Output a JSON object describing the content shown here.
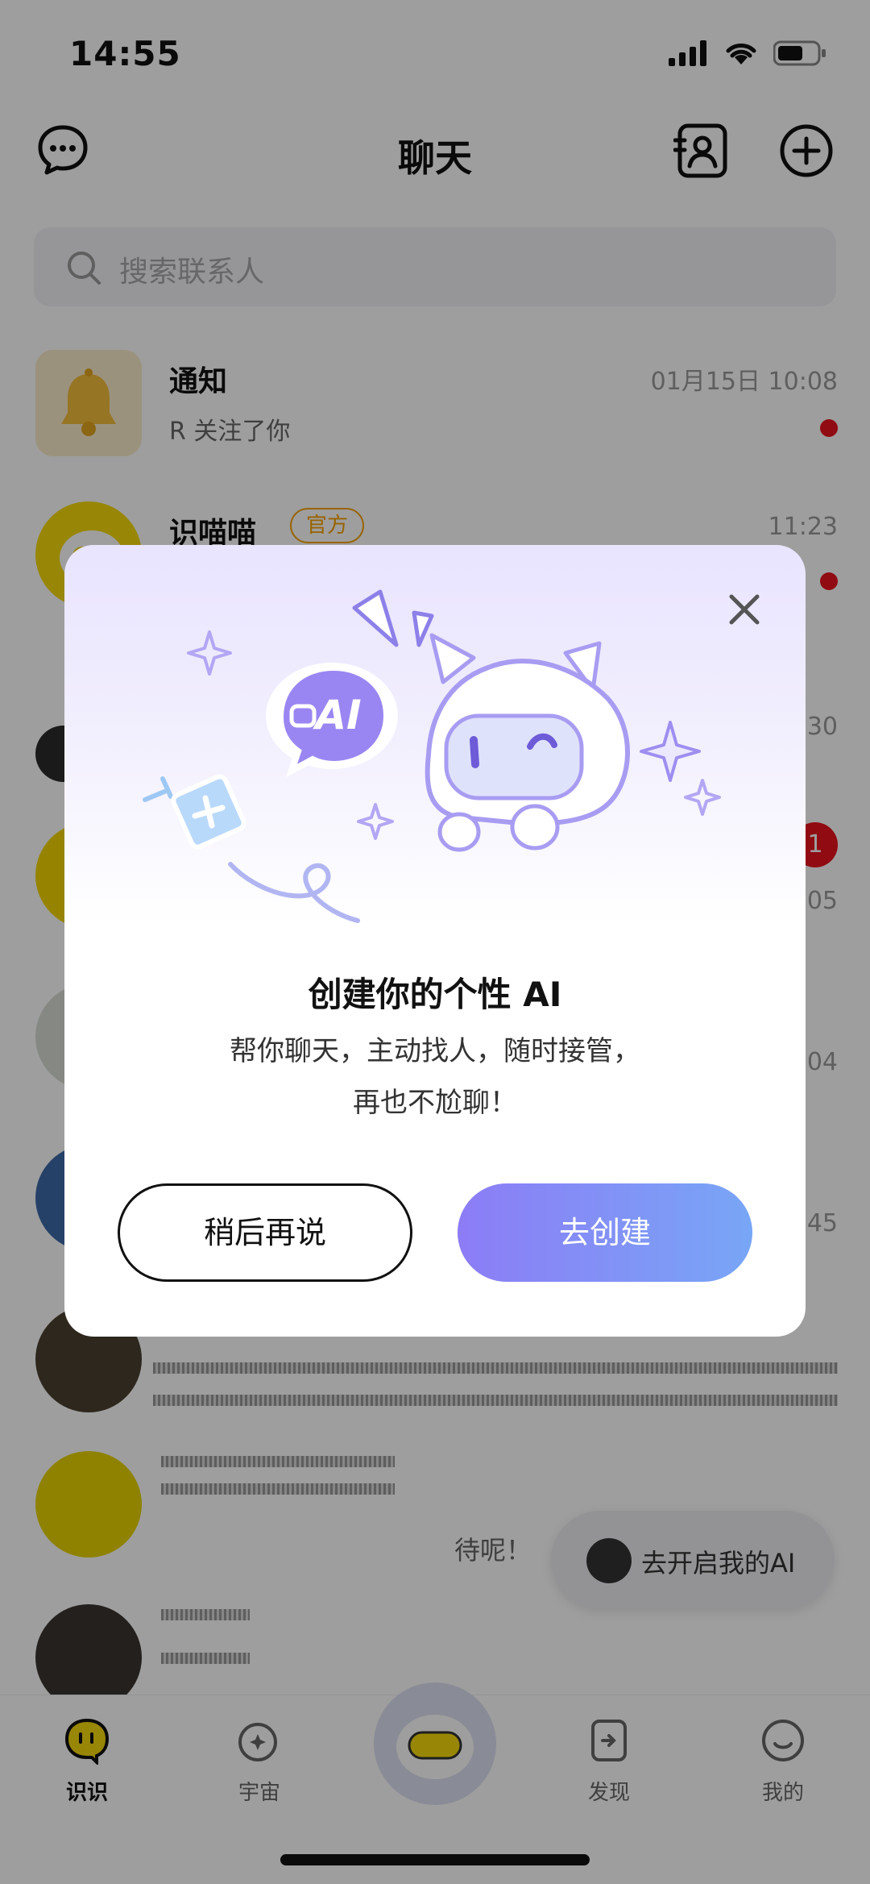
{
  "status_bar": {
    "time": "14:55"
  },
  "header": {
    "title": "聊天"
  },
  "search": {
    "placeholder": "搜索联系人"
  },
  "chats": [
    {
      "name": "通知",
      "message": "R 关注了你",
      "time": "01月15日 10:08",
      "unread_dot": true
    },
    {
      "name": "识喵喵",
      "tag": "官方",
      "time": "11:23",
      "unread_dot": true
    },
    {
      "time": "30"
    },
    {
      "badge": "1",
      "time": "05"
    },
    {
      "time": "04"
    },
    {
      "time": "45"
    }
  ],
  "partial_text": "待呢！",
  "floating_button": {
    "label": "去开启我的AI"
  },
  "modal": {
    "bubble_text": "AI",
    "title": "创建你的个性 AI",
    "desc_line1": "帮你聊天，主动找人，随时接管，",
    "desc_line2": "再也不尬聊！",
    "btn_later": "稍后再说",
    "btn_create": "去创建"
  },
  "tabbar": {
    "tabs": [
      {
        "label": "识识",
        "active": true
      },
      {
        "label": "宇宙",
        "active": false
      },
      {
        "label": "发现",
        "active": false
      },
      {
        "label": "我的",
        "active": false
      }
    ]
  },
  "colors": {
    "accent_gradient_start": "#8c7cf6",
    "accent_gradient_end": "#78a6f6",
    "unread_red": "#e8121d",
    "official_tag": "#f5a000"
  }
}
